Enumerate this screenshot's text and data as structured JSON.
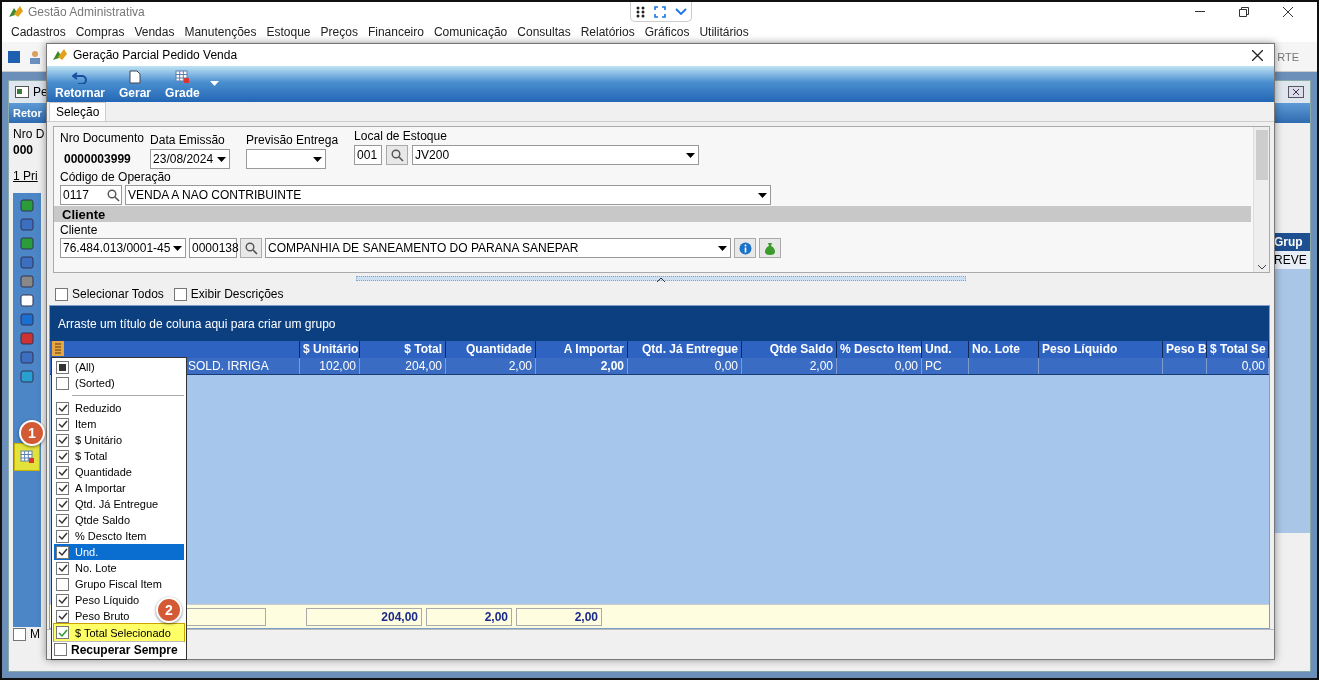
{
  "app": {
    "title": "Gestão Administrativa",
    "menu": [
      {
        "label": "Cadastros"
      },
      {
        "label": "Compras"
      },
      {
        "label": "Vendas"
      },
      {
        "label": "Manutenções"
      },
      {
        "label": "Estoque"
      },
      {
        "label": "Preços"
      },
      {
        "label": "Financeiro"
      },
      {
        "label": "Comunicação"
      },
      {
        "label": "Consultas"
      },
      {
        "label": "Relatórios"
      },
      {
        "label": "Gráficos"
      },
      {
        "label": "Utilitários"
      }
    ]
  },
  "background_window": {
    "title": "Pe",
    "toolbar_label": "Retor",
    "toolbar_text": "RTE",
    "field_label": "Nro D",
    "field_value": "000",
    "tab": "1 Pri",
    "column_header": "Grup",
    "cell": "REVE",
    "checkbox": {
      "label": "M",
      "checked": false
    }
  },
  "dialog": {
    "title": "Geração Parcial Pedido Venda",
    "toolbar": [
      {
        "label": "Retornar",
        "kind": "back"
      },
      {
        "label": "Gerar",
        "kind": "document"
      },
      {
        "label": "Grade",
        "kind": "grid"
      }
    ],
    "tabs": [
      {
        "label": "Seleção",
        "selected": true
      }
    ],
    "form": {
      "document_number": {
        "label": "Nro Documento",
        "value": "0000003999"
      },
      "issue_date": {
        "label": "Data Emissão",
        "value": "23/08/2024"
      },
      "delivery_forecast": {
        "label": "Previsão Entrega"
      },
      "stock_location": {
        "label": "Local de Estoque",
        "code": "001",
        "name": "JV200"
      },
      "operation": {
        "label": "Código de Operação",
        "code": "0117",
        "name": "VENDA A NAO CONTRIBUINTE"
      },
      "section": "Cliente",
      "customer": {
        "label": "Cliente",
        "document": "76.484.013/0001-45",
        "code": "0000138",
        "name": "COMPANHIA DE SANEAMENTO DO PARANA SANEPAR"
      }
    },
    "options": [
      {
        "label": "Selecionar Todos",
        "checked": false
      },
      {
        "label": "Exibir Descrições",
        "checked": false
      }
    ],
    "grid": {
      "group_hint": "Arraste um título de coluna aqui para criar um grupo",
      "columns": [
        {
          "kind": "text"
        },
        {
          "label": "$ Unitário",
          "kind": "number"
        },
        {
          "label": "$ Total",
          "kind": "number"
        },
        {
          "label": "Quantidade",
          "kind": "number"
        },
        {
          "label": "A Importar",
          "kind": "input"
        },
        {
          "label": "Qtd. Já Entregue",
          "kind": "number"
        },
        {
          "label": "Qtde Saldo",
          "kind": "number"
        },
        {
          "label": "% Descto Item",
          "kind": "number"
        },
        {
          "label": "Und.",
          "kind": "text"
        },
        {
          "label": "No. Lote",
          "kind": "text"
        },
        {
          "label": "Peso Líquido",
          "kind": "text"
        },
        {
          "label": "Peso B",
          "kind": "number"
        },
        {
          "label": "$ Total Se",
          "kind": "number"
        }
      ],
      "rows": [
        {
          "selected": true,
          "cells": [
            "SOLD. IRRIGA",
            "102,00",
            "204,00",
            "2,00",
            "2,00",
            "0,00",
            "2,00",
            "0,00",
            "PC",
            "",
            "",
            "",
            "0,00"
          ]
        }
      ],
      "totals": [
        "204,00",
        "2,00",
        "2,00"
      ]
    }
  },
  "column_chooser": {
    "all": {
      "label": "(All)",
      "partial": true
    },
    "sorted": {
      "label": "(Sorted)",
      "checked": false
    },
    "columns": [
      {
        "label": "Reduzido",
        "checked": true,
        "selected": false,
        "highlighted": false
      },
      {
        "label": "Item",
        "checked": true,
        "selected": false,
        "highlighted": false
      },
      {
        "label": "$ Unitário",
        "checked": true,
        "selected": false,
        "highlighted": false
      },
      {
        "label": "$ Total",
        "checked": true,
        "selected": false,
        "highlighted": false
      },
      {
        "label": "Quantidade",
        "checked": true,
        "selected": false,
        "highlighted": false
      },
      {
        "label": "A Importar",
        "checked": true,
        "selected": false,
        "highlighted": false
      },
      {
        "label": "Qtd. Já Entregue",
        "checked": true,
        "selected": false,
        "highlighted": false
      },
      {
        "label": "Qtde Saldo",
        "checked": true,
        "selected": false,
        "highlighted": false
      },
      {
        "label": "% Descto Item",
        "checked": true,
        "selected": false,
        "highlighted": false
      },
      {
        "label": "Und.",
        "checked": true,
        "selected": true,
        "highlighted": false
      },
      {
        "label": "No. Lote",
        "checked": true,
        "selected": false,
        "highlighted": false
      },
      {
        "label": "Grupo Fiscal Item",
        "checked": false,
        "selected": false,
        "highlighted": false
      },
      {
        "label": "Peso Líquido",
        "checked": true,
        "selected": false,
        "highlighted": false
      },
      {
        "label": "Peso Bruto",
        "checked": true,
        "selected": false,
        "highlighted": false
      },
      {
        "label": "$ Total Selecionado",
        "checked": true,
        "selected": false,
        "highlighted": true
      }
    ],
    "keep": {
      "label": "Recuperar Sempre",
      "checked": false
    }
  },
  "annotations": [
    {
      "label": "1"
    },
    {
      "label": "2"
    }
  ]
}
